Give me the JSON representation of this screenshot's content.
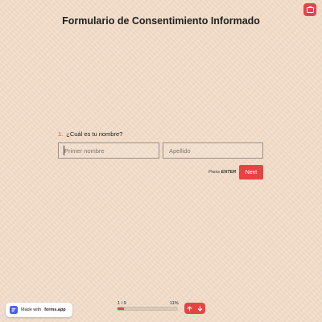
{
  "form": {
    "title": "Formulario de Consentimiento Informado",
    "question_number": "1.",
    "question_text": "¿Cuál es tu nombre?",
    "first_name_placeholder": "Primer nombre",
    "last_name_placeholder": "Apellido",
    "first_name_value": "",
    "last_name_value": "",
    "press_label": "Press",
    "press_key": "ENTER",
    "next_label": "Next"
  },
  "footer": {
    "made_with": "Made with",
    "brand": "forms.app",
    "progress_count": "1 / 9",
    "progress_percent_label": "11%",
    "progress_fraction": 0.11
  },
  "icons": {
    "top_action": "document-icon",
    "badge_logo": "forms-app-logo-icon",
    "nav_up": "arrow-up-icon",
    "nav_down": "arrow-down-icon"
  },
  "colors": {
    "accent": "#e84343",
    "background": "#f3ddc9",
    "text": "#1f1f1f"
  }
}
